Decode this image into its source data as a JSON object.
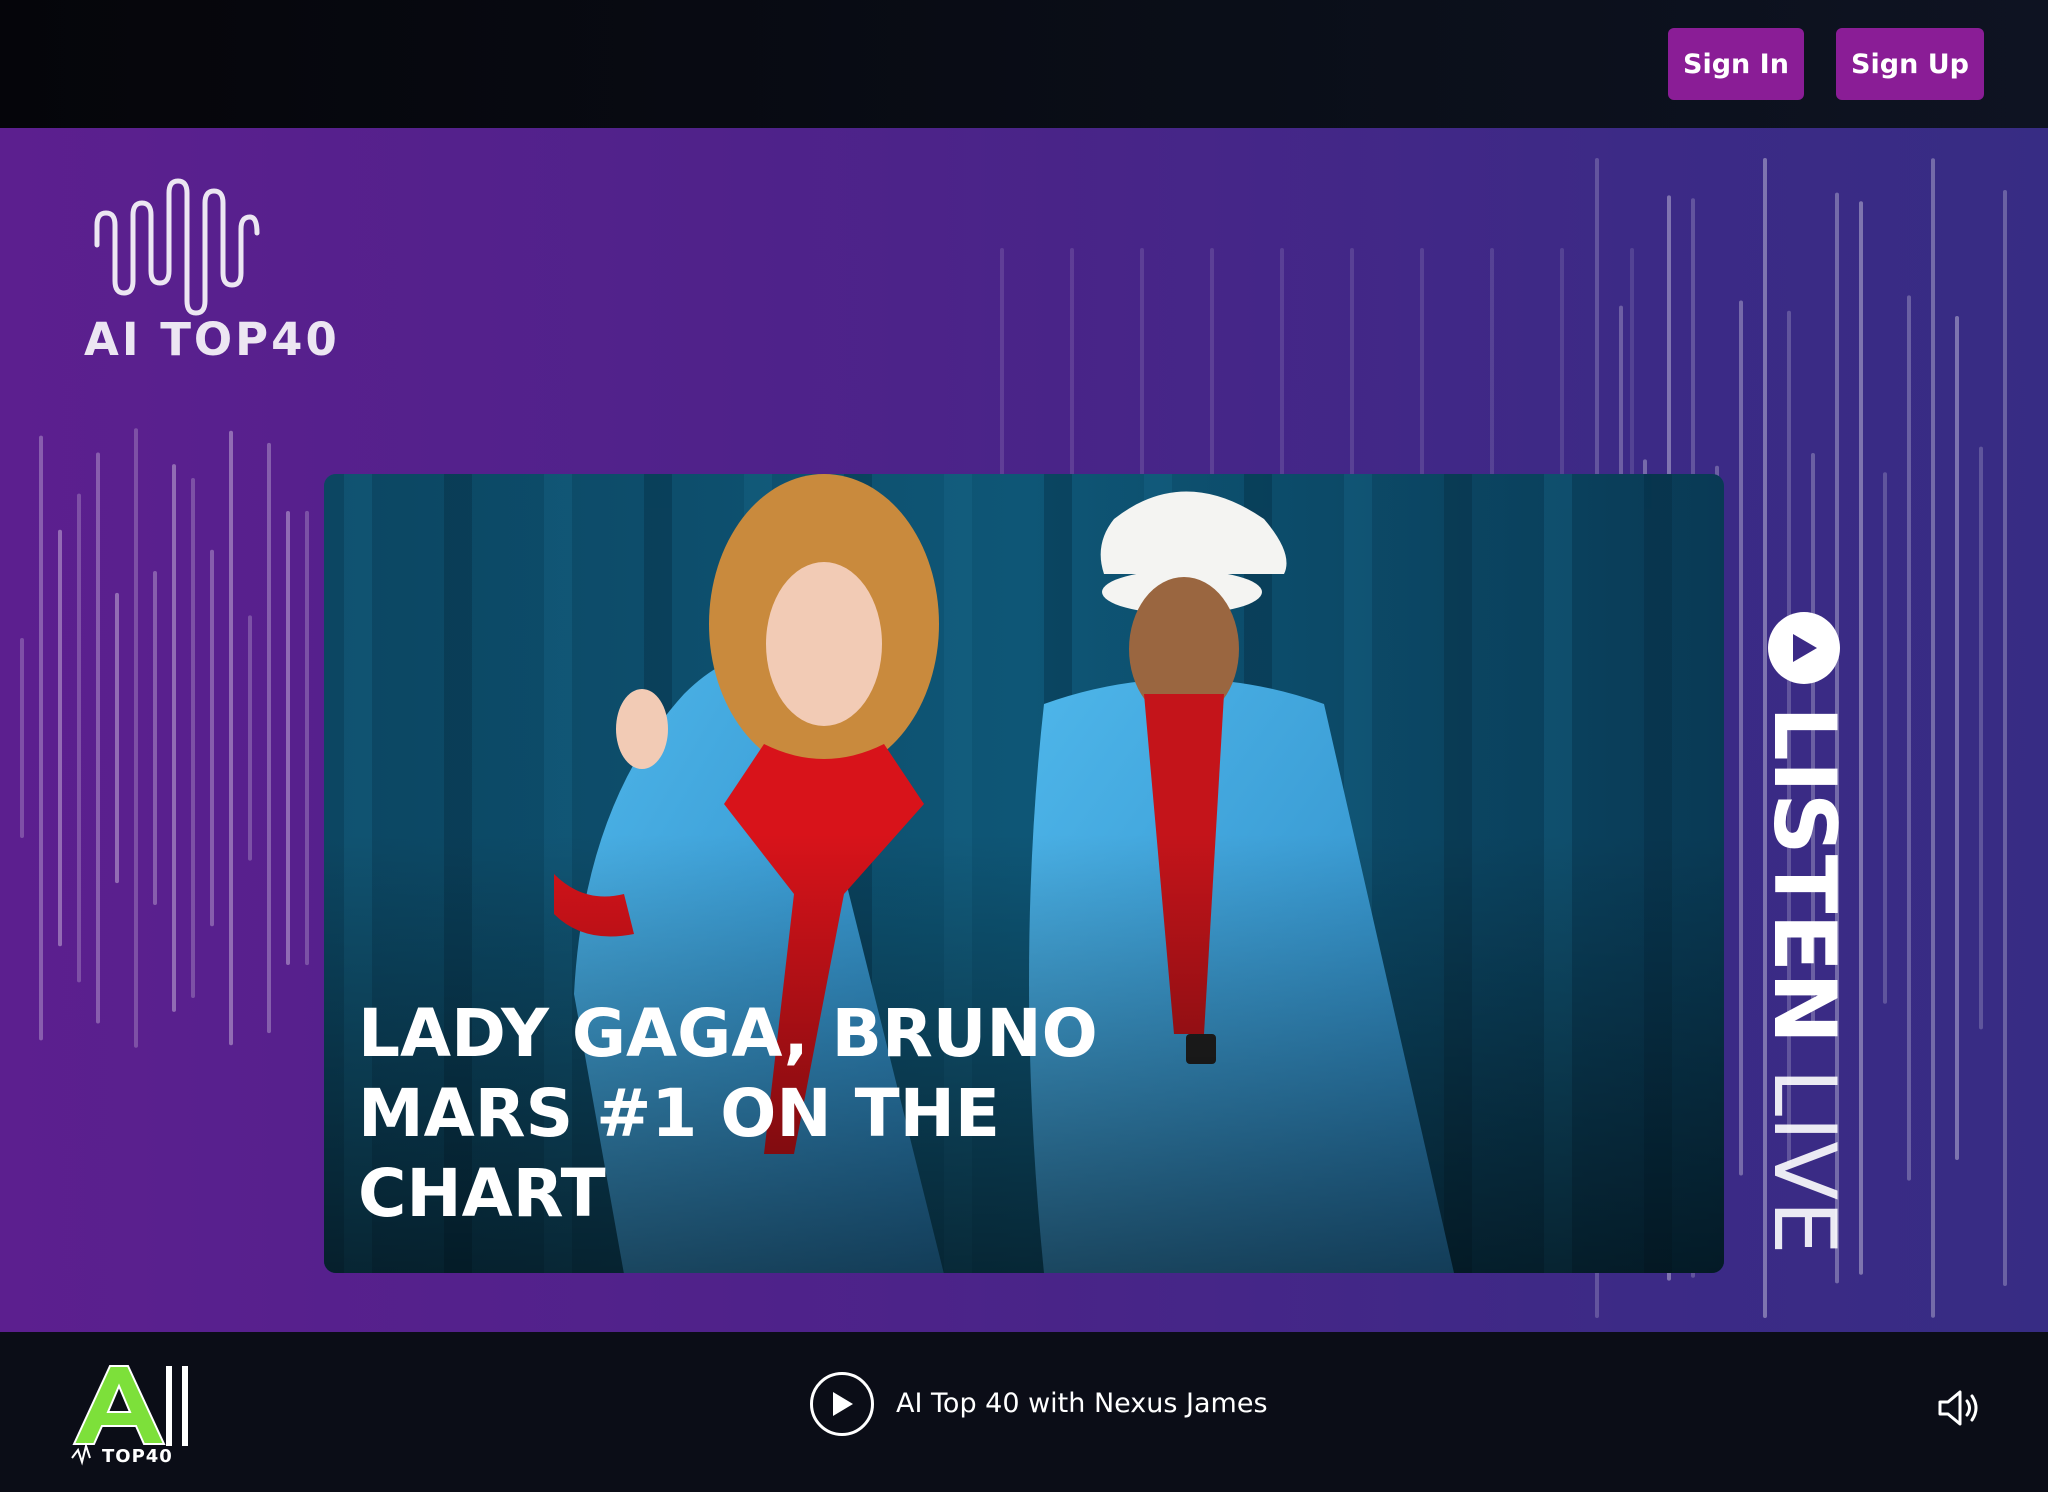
{
  "header": {
    "sign_in_label": "Sign In",
    "sign_up_label": "Sign Up",
    "button_color": "#8a1d96"
  },
  "brand": {
    "logo_text": "AI TOP40",
    "logo_icon": "soundwave-icon"
  },
  "feature": {
    "headline": "LADY GAGA, BRUNO MARS #1 ON THE CHART"
  },
  "listen_live": {
    "bold_text": "LISTEN",
    "light_text": "LIVE",
    "icon": "play-circle-icon"
  },
  "player": {
    "logo_text": "TOP40",
    "now_playing": "AI Top 40 with Nexus James",
    "play_icon": "play-icon",
    "volume_icon": "volume-icon",
    "accent": "#7de03a"
  },
  "colors": {
    "hero_left": "#5c1f8f",
    "hero_right": "#372c84",
    "dark": "#0b0d17"
  }
}
